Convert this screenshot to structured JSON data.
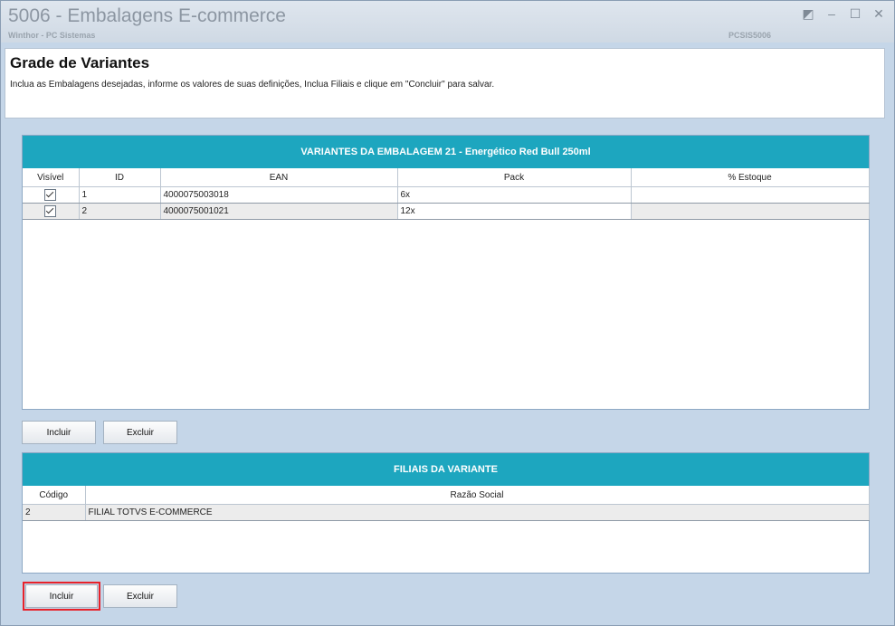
{
  "window": {
    "title": "5006 - Embalagens E-commerce",
    "subtitle": "Winthor - PC Sistemas",
    "code": "PCSIS5006",
    "controls": [
      "◩",
      "–",
      "☐",
      "✕"
    ]
  },
  "header": {
    "title": "Grade de Variantes",
    "description": "Inclua as Embalagens desejadas, informe os valores de suas definições, Inclua Filiais e clique em \"Concluir\" para salvar."
  },
  "variants": {
    "title": "VARIANTES DA EMBALAGEM 21 - Energético Red Bull 250ml",
    "columns": [
      "Visível",
      "ID",
      "EAN",
      "Pack",
      "% Estoque"
    ],
    "rows": [
      {
        "visible": true,
        "id": "1",
        "ean": "4000075003018",
        "pack": "6x",
        "estoque": ""
      },
      {
        "visible": true,
        "id": "2",
        "ean": "4000075001021",
        "pack": "12x",
        "estoque": ""
      }
    ],
    "include_label": "Incluir",
    "delete_label": "Excluir"
  },
  "branches": {
    "title": "FILIAIS DA VARIANTE",
    "columns": [
      "Código",
      "Razão Social"
    ],
    "rows": [
      {
        "codigo": "2",
        "razao": "FILIAL TOTVS E-COMMERCE"
      }
    ],
    "include_label": "Incluir",
    "delete_label": "Excluir"
  }
}
